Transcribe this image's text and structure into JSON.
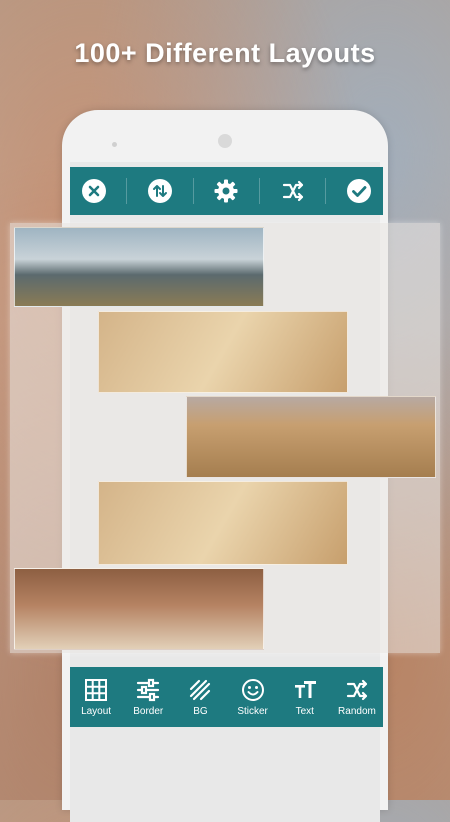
{
  "headline": "100+ Different Layouts",
  "toolbar": {
    "items": [
      {
        "icon": "close-icon"
      },
      {
        "icon": "swap-icon"
      },
      {
        "icon": "gear-icon"
      },
      {
        "icon": "shuffle-icon"
      },
      {
        "icon": "check-icon"
      }
    ]
  },
  "bottom_bar": {
    "items": [
      {
        "label": "Layout",
        "icon": "grid-icon"
      },
      {
        "label": "Border",
        "icon": "sliders-icon"
      },
      {
        "label": "BG",
        "icon": "diagonal-lines-icon"
      },
      {
        "label": "Sticker",
        "icon": "smiley-icon"
      },
      {
        "label": "Text",
        "icon": "text-size-icon"
      },
      {
        "label": "Random",
        "icon": "shuffle-icon"
      }
    ]
  },
  "colors": {
    "accent": "#1e7a80",
    "phone_body": "#f2f2f2"
  }
}
